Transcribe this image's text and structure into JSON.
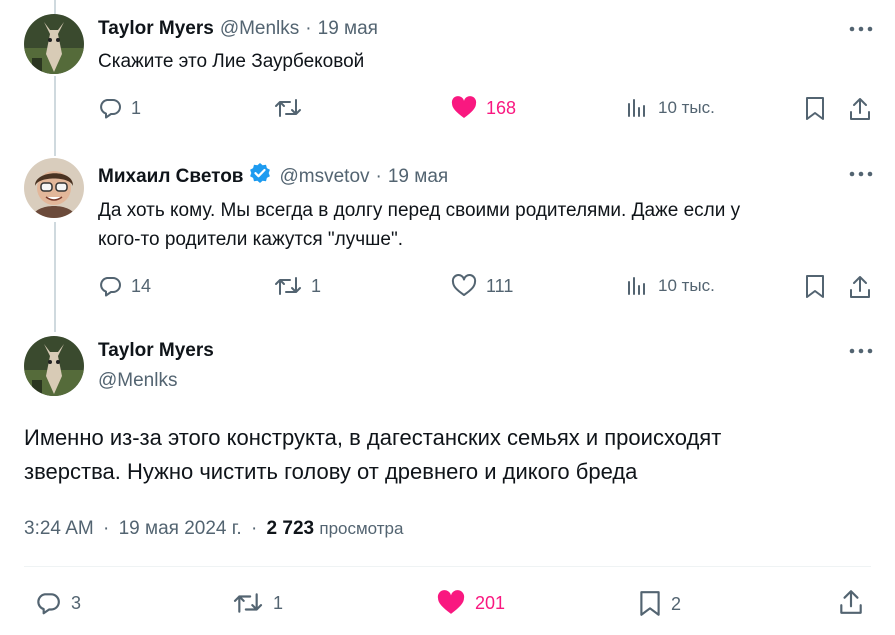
{
  "colors": {
    "accent_like": "#f91880",
    "verified": "#1d9bf0",
    "muted": "#536471",
    "text": "#0f1419"
  },
  "tweets": [
    {
      "name": "Taylor Myers",
      "handle": "@Menlks",
      "dot": "·",
      "date": "19 мая",
      "text": "Скажите это Лие Заурбековой",
      "replies": "1",
      "retweets": "",
      "likes": "168",
      "liked": true,
      "views": "10 тыс."
    },
    {
      "name": "Михаил Светов",
      "handle": "@msvetov",
      "dot": "·",
      "date": "19 мая",
      "verified": true,
      "text_line1": "Да хоть кому. Мы всегда в долгу перед своими родителями. Даже если у",
      "text_line2": "кого-то родители кажутся \"лучше\".",
      "replies": "14",
      "retweets": "1",
      "likes": "111",
      "liked": false,
      "views": "10 тыс."
    }
  ],
  "main": {
    "name": "Taylor Myers",
    "handle": "@Menlks",
    "text_line1": "Именно из-за этого конструкта, в дагестанских семьях и происходят",
    "text_line2": "зверства. Нужно чистить голову от древнего и дикого бреда",
    "time": "3:24 AM",
    "dot": "·",
    "date": "19 мая 2024 г.",
    "dot2": "·",
    "views_count": "2 723",
    "views_label": "просмотра",
    "replies": "3",
    "retweets": "1",
    "likes": "201",
    "bookmarks": "2"
  },
  "icons": [
    "more-icon",
    "reply-icon",
    "retweet-icon",
    "like-icon",
    "views-icon",
    "bookmark-icon",
    "share-icon",
    "verified-icon"
  ]
}
